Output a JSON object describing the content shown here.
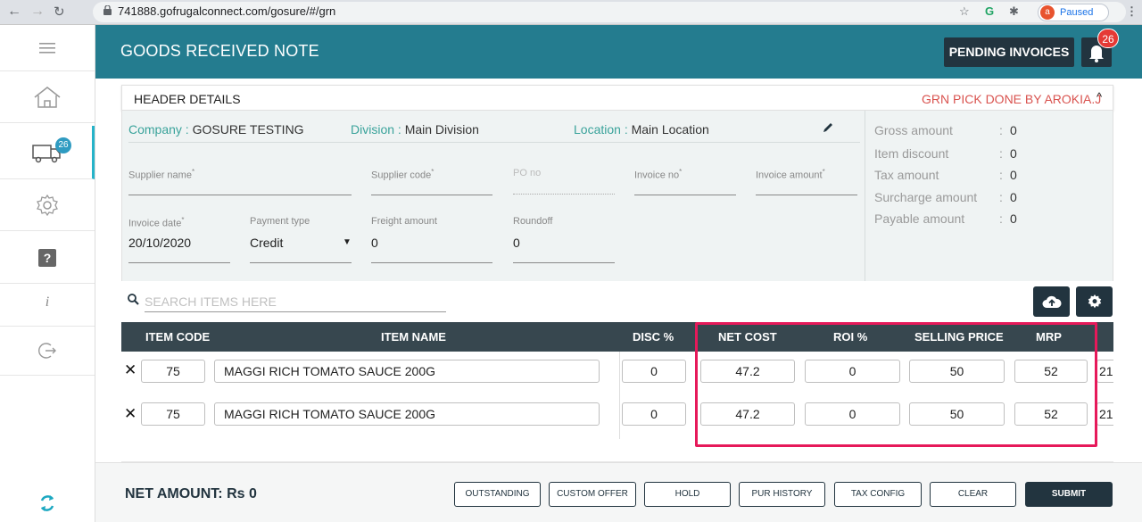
{
  "browser": {
    "url": "741888.gofrugalconnect.com/gosure/#/grn",
    "profile_initial": "a",
    "paused_label": "Paused"
  },
  "sidebar": {
    "items": [
      {
        "icon": "menu-icon"
      },
      {
        "icon": "home-icon"
      },
      {
        "icon": "truck-icon",
        "badge": "26"
      },
      {
        "icon": "gear-icon"
      },
      {
        "icon": "help-icon",
        "glyph": "?"
      },
      {
        "icon": "info-icon",
        "glyph": "i"
      },
      {
        "icon": "logout-icon"
      }
    ]
  },
  "header": {
    "title": "GOODS RECEIVED NOTE",
    "pending_invoices": "PENDING INVOICES",
    "notification_count": "26"
  },
  "header_details": {
    "title": "HEADER DETAILS",
    "pick_done": "GRN PICK DONE BY AROKIA.J",
    "company_label": "Company :",
    "company": "GOSURE TESTING",
    "division_label": "Division :",
    "division": "Main Division",
    "location_label": "Location :",
    "location": "Main Location",
    "fields": {
      "supplier_name": "Supplier name",
      "supplier_code": "Supplier code",
      "po_no": "PO no",
      "invoice_no": "Invoice no",
      "invoice_amount": "Invoice amount",
      "invoice_date": "Invoice date",
      "invoice_date_value": "20/10/2020",
      "payment_type": "Payment type",
      "payment_type_value": "Credit",
      "freight_amount": "Freight amount",
      "freight_amount_value": "0",
      "roundoff": "Roundoff",
      "roundoff_value": "0"
    }
  },
  "summary": [
    {
      "label": "Gross amount",
      "value": "0"
    },
    {
      "label": "Item discount",
      "value": "0"
    },
    {
      "label": "Tax amount",
      "value": "0"
    },
    {
      "label": "Surcharge amount",
      "value": "0"
    },
    {
      "label": "Payable amount",
      "value": "0"
    }
  ],
  "search": {
    "placeholder": "SEARCH ITEMS HERE"
  },
  "table": {
    "columns": [
      "ITEM CODE",
      "ITEM NAME",
      "DISC %",
      "NET COST",
      "ROI %",
      "SELLING PRICE",
      "MRP"
    ],
    "rows": [
      {
        "item_code": "75",
        "item_name": "MAGGI RICH TOMATO SAUCE 200G",
        "disc": "0",
        "net_cost": "47.2",
        "roi": "0",
        "selling_price": "50",
        "mrp": "52",
        "extra": "21"
      },
      {
        "item_code": "75",
        "item_name": "MAGGI RICH TOMATO SAUCE 200G",
        "disc": "0",
        "net_cost": "47.2",
        "roi": "0",
        "selling_price": "50",
        "mrp": "52",
        "extra": "21"
      }
    ]
  },
  "footer": {
    "net_amount": "NET AMOUNT:  Rs 0",
    "buttons": [
      "OUTSTANDING",
      "CUSTOM OFFER",
      "HOLD",
      "PUR HISTORY",
      "TAX CONFIG",
      "CLEAR",
      "SUBMIT"
    ]
  },
  "colors": {
    "header_bar": "#247c8f",
    "dark_button": "#22343f",
    "accent_teal": "#3aa39b",
    "highlight_box": "#e6195a",
    "alert_text": "#d9534f"
  }
}
